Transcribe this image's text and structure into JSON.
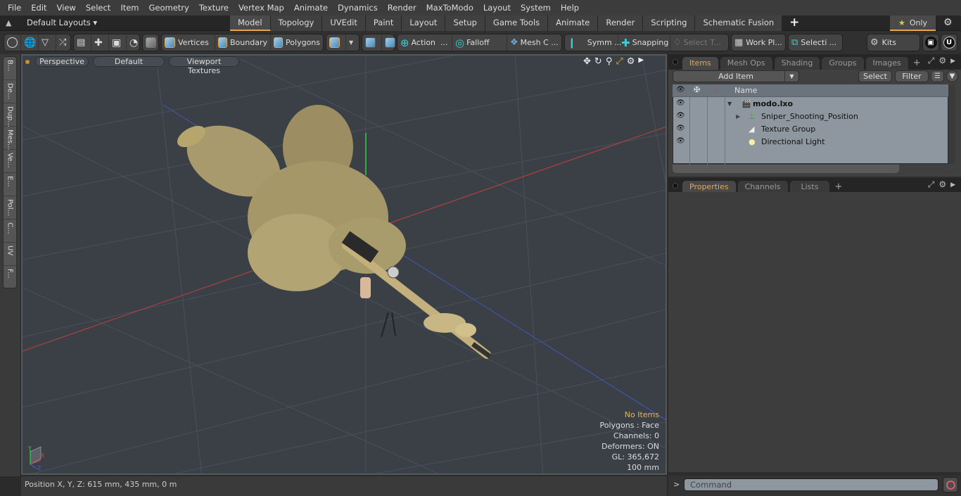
{
  "menu": [
    "File",
    "Edit",
    "View",
    "Select",
    "Item",
    "Geometry",
    "Texture",
    "Vertex Map",
    "Animate",
    "Dynamics",
    "Render",
    "MaxToModo",
    "Layout",
    "System",
    "Help"
  ],
  "layout_bar": {
    "layouts_label": "Default Layouts ▾",
    "tabs": [
      {
        "label": "Model",
        "active": true
      },
      {
        "label": "Topology"
      },
      {
        "label": "UVEdit"
      },
      {
        "label": "Paint"
      },
      {
        "label": "Layout"
      },
      {
        "label": "Setup"
      },
      {
        "label": "Game Tools"
      },
      {
        "label": "Animate"
      },
      {
        "label": "Render"
      },
      {
        "label": "Scripting"
      },
      {
        "label": "Schematic Fusion"
      }
    ],
    "add_tab": "+",
    "only_label": "Only",
    "star": "★"
  },
  "toolbar": {
    "vertices": "Vertices",
    "boundary": "Boundary",
    "polygons": "Polygons",
    "action": "Action",
    "action_more": "...",
    "falloff": "Falloff",
    "mesh_c": "Mesh C ...",
    "symm": "Symm ...",
    "snapping": "Snapping",
    "select_t": "Select T...",
    "work_pl": "Work Pl...",
    "selecti": "Selecti ...",
    "kits": "Kits"
  },
  "left_tabs": [
    "B...",
    "De...",
    "Dup...",
    "Mes...",
    "Ve...",
    "E...",
    "Pol...",
    "C...",
    "UV",
    "F..."
  ],
  "viewport": {
    "view_mode": "Perspective",
    "shading": "Default",
    "textures": "Viewport Textures",
    "stats": {
      "selection": "No Items",
      "polygons": "Polygons : Face",
      "channels": "Channels: 0",
      "deformers": "Deformers: ON",
      "gl": "GL: 365,672",
      "grid": "100 mm"
    },
    "axis_labels": {
      "x": "X",
      "y": "Y",
      "z": "Z"
    }
  },
  "status": {
    "position": "Position X, Y, Z:   615 mm, 435 mm, 0 m"
  },
  "items_panel": {
    "tabs": [
      {
        "label": "Items",
        "active": true
      },
      {
        "label": "Mesh Ops"
      },
      {
        "label": "Shading"
      },
      {
        "label": "Groups"
      },
      {
        "label": "Images"
      }
    ],
    "add_item": "Add Item",
    "select": "Select",
    "filter": "Filter",
    "column_name": "Name",
    "tree": [
      {
        "name": "modo.lxo",
        "icon": "scene-icon",
        "level": 0,
        "bold": true,
        "expanded": true
      },
      {
        "name": "Sniper_Shooting_Position",
        "icon": "locator-icon",
        "level": 1,
        "collapsed": true
      },
      {
        "name": "Texture Group",
        "icon": "texture-group-icon",
        "level": 1
      },
      {
        "name": "Directional Light",
        "icon": "light-icon",
        "level": 1
      }
    ]
  },
  "props_panel": {
    "tabs": [
      {
        "label": "Properties",
        "active": true
      },
      {
        "label": "Channels"
      },
      {
        "label": "Lists"
      }
    ]
  },
  "command": {
    "prompt": ">",
    "placeholder": "Command"
  },
  "colors": {
    "accent": "#e8a64b",
    "viewport_bg": "#3b4047",
    "x_axis": "#d0403c",
    "y_axis": "#3cc850",
    "z_axis": "#4060d0"
  }
}
